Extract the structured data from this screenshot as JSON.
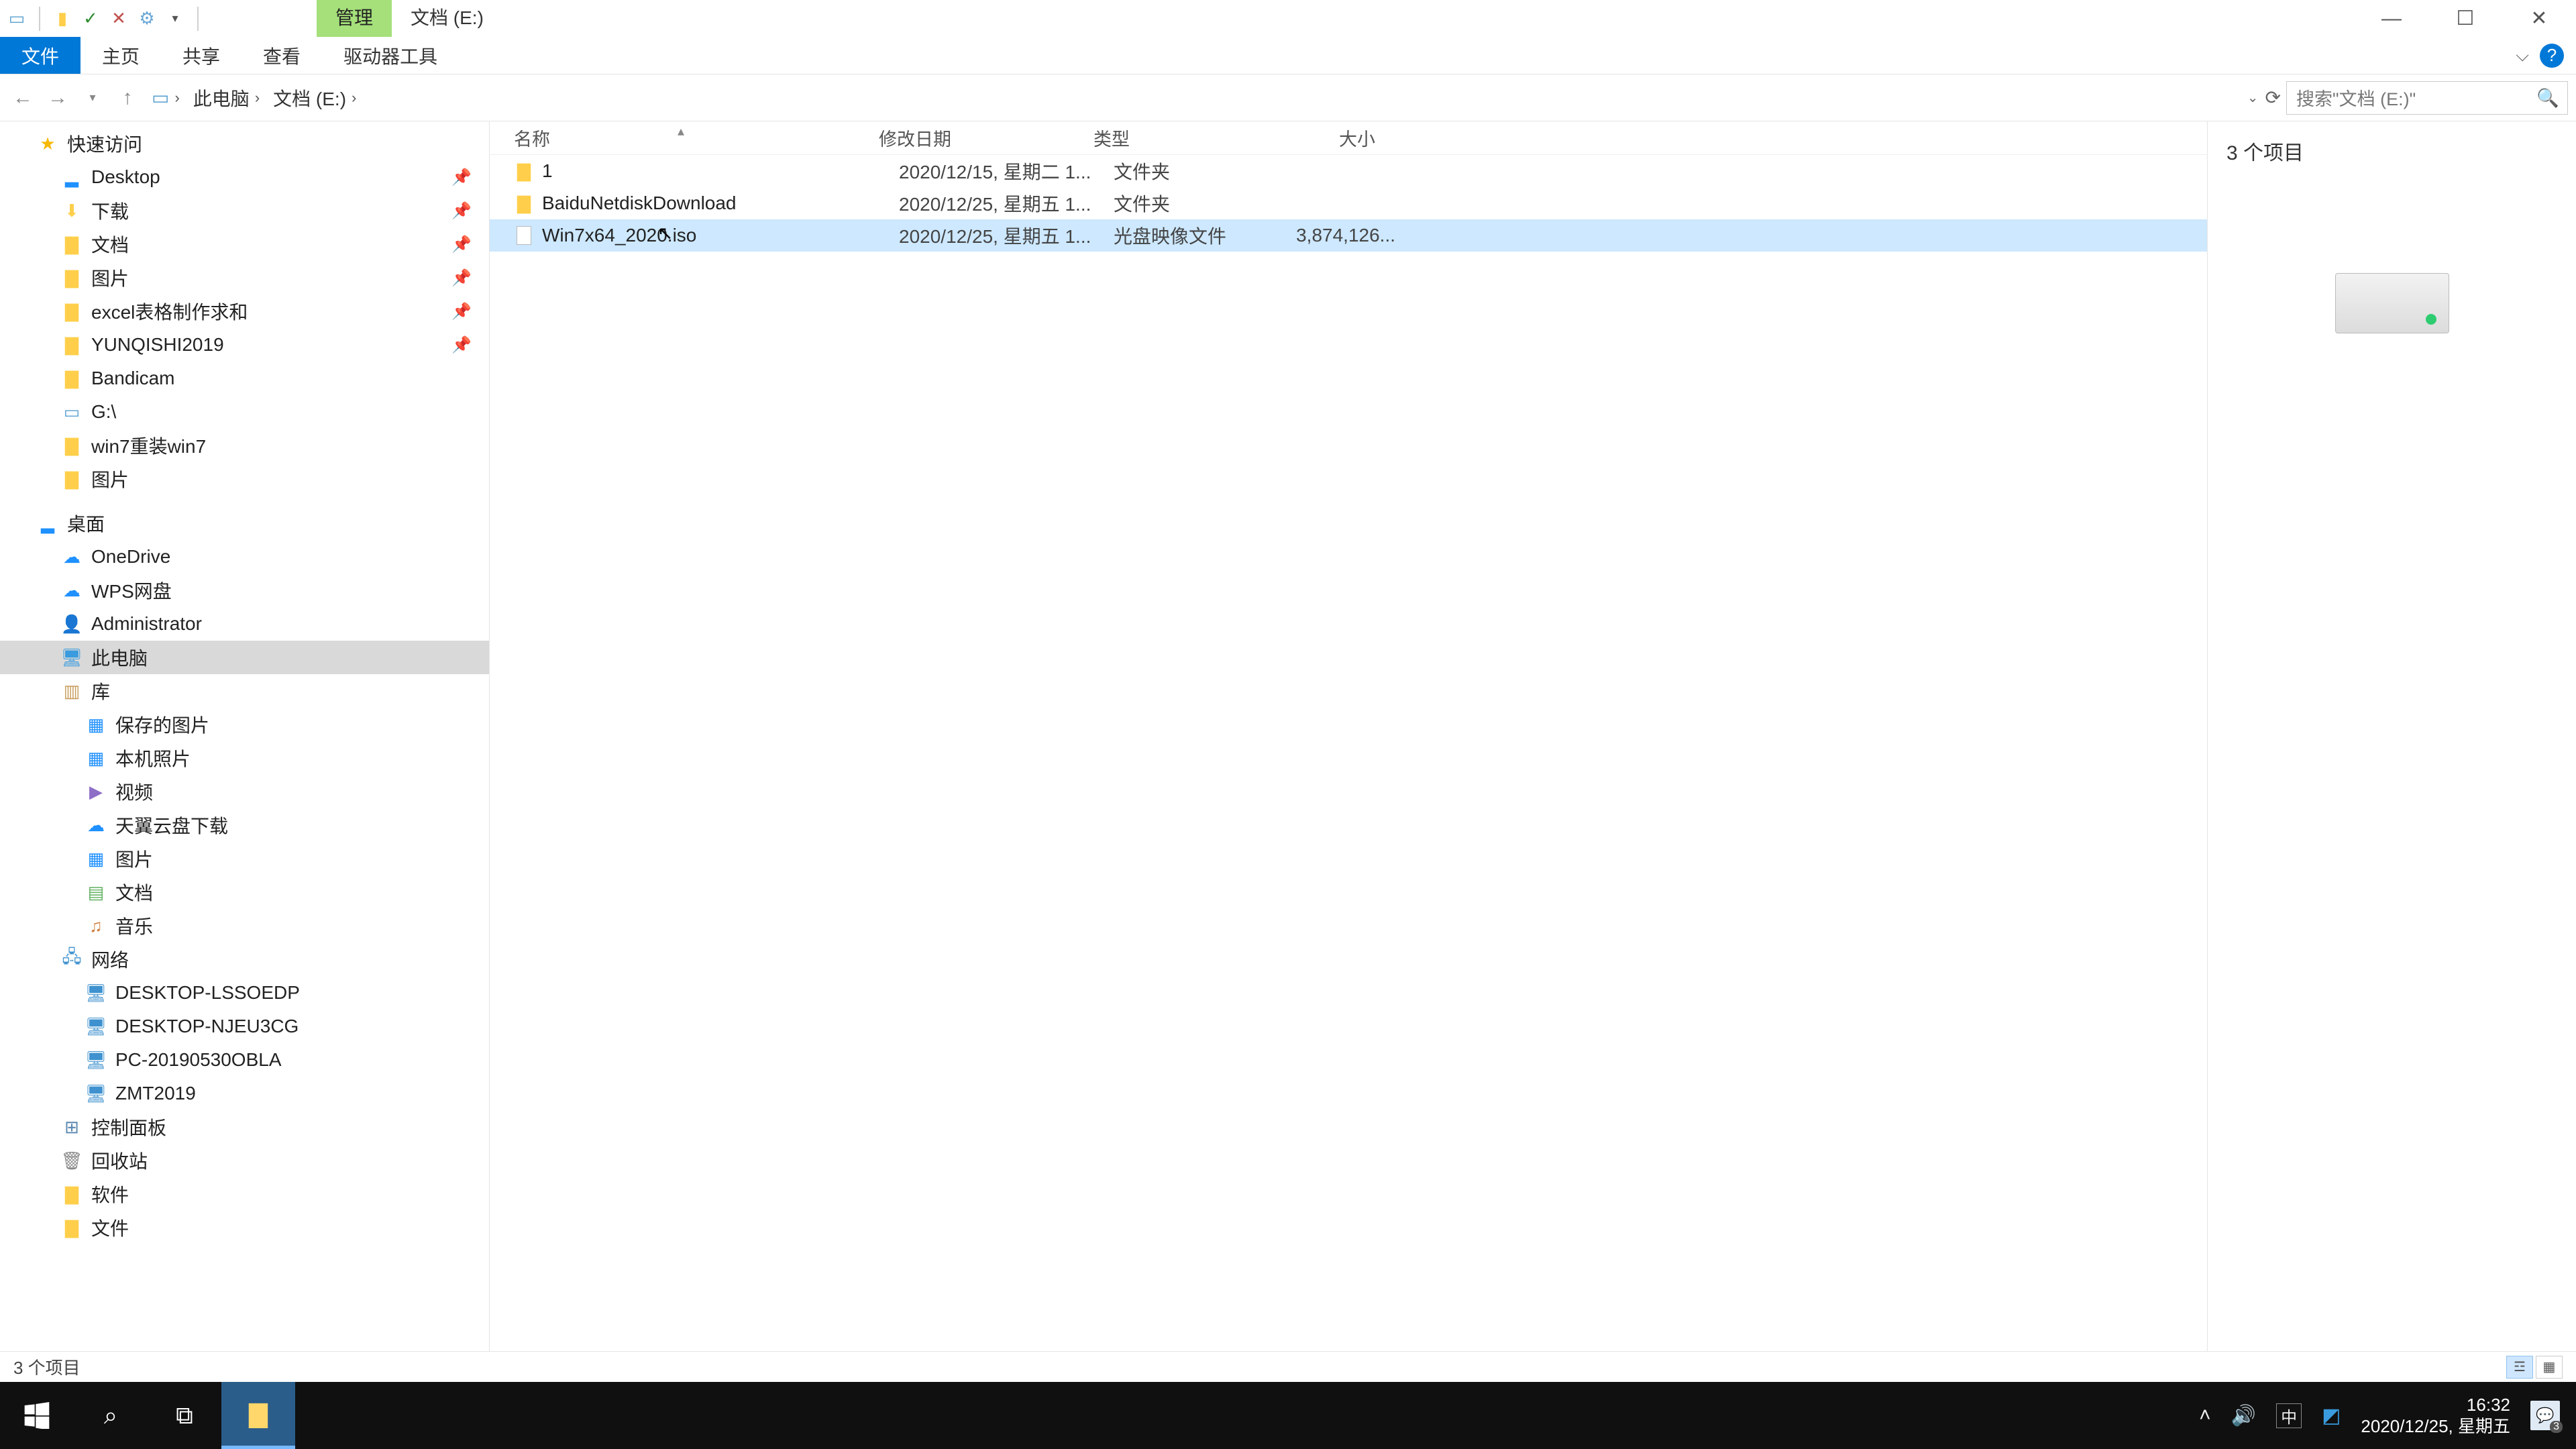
{
  "titlebar": {
    "context_tab": "管理",
    "location_tab": "文档 (E:)"
  },
  "ribbon": {
    "file": "文件",
    "home": "主页",
    "share": "共享",
    "view": "查看",
    "drive_tools": "驱动器工具"
  },
  "breadcrumbs": [
    "此电脑",
    "文档 (E:)"
  ],
  "search": {
    "placeholder": "搜索\"文档 (E:)\""
  },
  "nav": {
    "quick_access": "快速访问",
    "qa_items": [
      {
        "label": "Desktop"
      },
      {
        "label": "下载"
      },
      {
        "label": "文档"
      },
      {
        "label": "图片"
      },
      {
        "label": "excel表格制作求和"
      },
      {
        "label": "YUNQISHI2019"
      },
      {
        "label": "Bandicam"
      },
      {
        "label": "G:\\"
      },
      {
        "label": "win7重装win7"
      },
      {
        "label": "图片"
      }
    ],
    "desktop": "桌面",
    "onedrive": "OneDrive",
    "wps": "WPS网盘",
    "admin": "Administrator",
    "this_pc": "此电脑",
    "libraries": "库",
    "lib_items": [
      "保存的图片",
      "本机照片",
      "视频",
      "天翼云盘下载",
      "图片",
      "文档",
      "音乐"
    ],
    "network": "网络",
    "net_items": [
      "DESKTOP-LSSOEDP",
      "DESKTOP-NJEU3CG",
      "PC-20190530OBLA",
      "ZMT2019"
    ],
    "control_panel": "控制面板",
    "recycle": "回收站",
    "soft": "软件",
    "files_folder": "文件"
  },
  "columns": {
    "name": "名称",
    "date": "修改日期",
    "type": "类型",
    "size": "大小"
  },
  "rows": [
    {
      "name": "1",
      "date": "2020/12/15, 星期二 1...",
      "type": "文件夹",
      "size": "",
      "icon": "folder"
    },
    {
      "name": "BaiduNetdiskDownload",
      "date": "2020/12/25, 星期五 1...",
      "type": "文件夹",
      "size": "",
      "icon": "folder"
    },
    {
      "name": "Win7x64_2020.iso",
      "date": "2020/12/25, 星期五 1...",
      "type": "光盘映像文件",
      "size": "3,874,126...",
      "icon": "file",
      "selected": true
    }
  ],
  "preview": {
    "summary": "3 个项目"
  },
  "status": {
    "text": "3 个项目"
  },
  "taskbar": {
    "time": "16:32",
    "date": "2020/12/25, 星期五",
    "ime": "中",
    "notif_count": "3"
  }
}
